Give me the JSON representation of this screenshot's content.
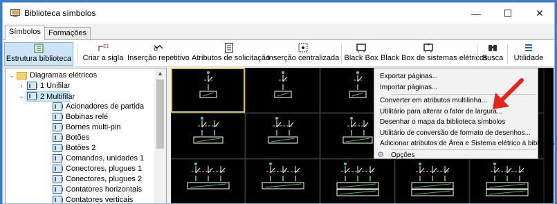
{
  "window": {
    "title": "Biblioteca símbolos",
    "minimize": "—",
    "maximize": "☐",
    "close": "✕"
  },
  "tabs": [
    {
      "label": "Símbolos",
      "active": true
    },
    {
      "label": "Formações",
      "active": false
    }
  ],
  "toolbar": {
    "structure": "Estrutura biblioteca",
    "create_acronym": "Criar a sigla",
    "repeat_insert": "Inserção repetitivo",
    "request_attrs": "Atributos de solicitação",
    "center_insert": "Inserção centralizada",
    "black_box": "Black Box",
    "black_box_systems": "Black Box de sistemas elétricos",
    "search": "Busca",
    "utility": "Utilidade"
  },
  "tree": {
    "root": "Diagramas elétricos",
    "unifilar": "1 Unifilar",
    "multifilar": "2 Multifilar",
    "items": [
      "Acionadores de partida",
      "Bobinas relé",
      "Bornes multi-pin",
      "Botões",
      "Botões 2",
      "Comandos, unidades 1",
      "Conectores, plugues 1",
      "Conectores, plugues 2",
      "Contatores horizontais",
      "Contatores verticais"
    ]
  },
  "menu": {
    "export_pages": "Exportar páginas...",
    "import_pages": "Importar páginas...",
    "convert_attrs": "Converter em atributos multilinha...",
    "width_factor": "Utilitário para alterar o fator de largura...",
    "draw_map": "Desenhar o mapa da biblioteca símbolos",
    "convert_format": "Utilitário de conversão de formato de desenhos...",
    "add_area_attrs": "Adicionar atributos de Área e Sistema elétrico à biblioteca...",
    "options": "Opções"
  },
  "colors": {
    "accent": "#3a7ecb",
    "arrow": "#e8231b",
    "symbol_green": "#3ec23e",
    "symbol_yellow": "#e8d34a"
  }
}
